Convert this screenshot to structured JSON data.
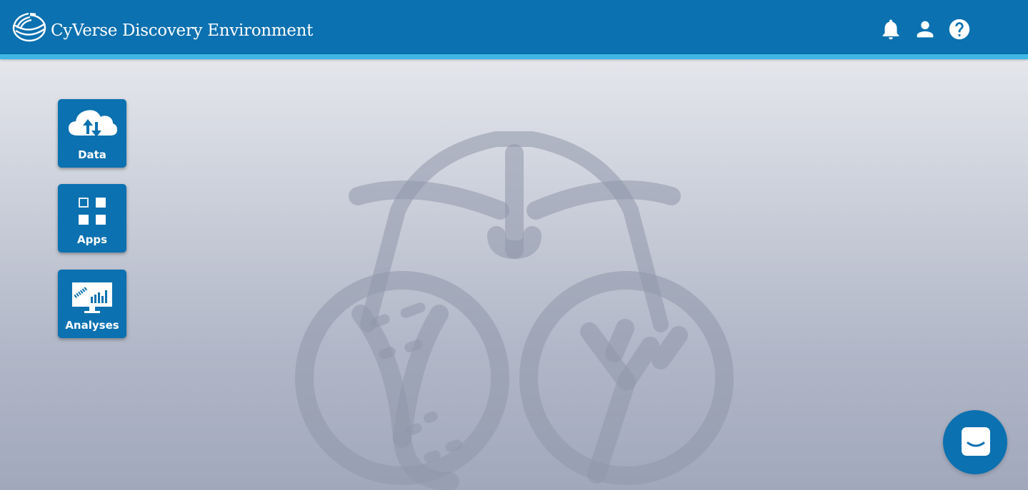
{
  "header": {
    "title": "CyVerse Discovery Environment",
    "brand_color": "#0b71b0",
    "accent_color": "#3fb6e6",
    "logo_icon": "cyverse-logo-icon",
    "icons": [
      "notifications-bell-icon",
      "user-account-icon",
      "help-icon"
    ]
  },
  "nav": {
    "tiles": [
      {
        "label": "Data",
        "icon": "cloud-upload-download-icon"
      },
      {
        "label": "Apps",
        "icon": "apps-grid-icon"
      },
      {
        "label": "Analyses",
        "icon": "analyses-monitor-icon"
      }
    ]
  },
  "watermark": {
    "icon": "cyverse-emblem-watermark-icon"
  },
  "chat": {
    "icon": "chat-smile-icon"
  }
}
